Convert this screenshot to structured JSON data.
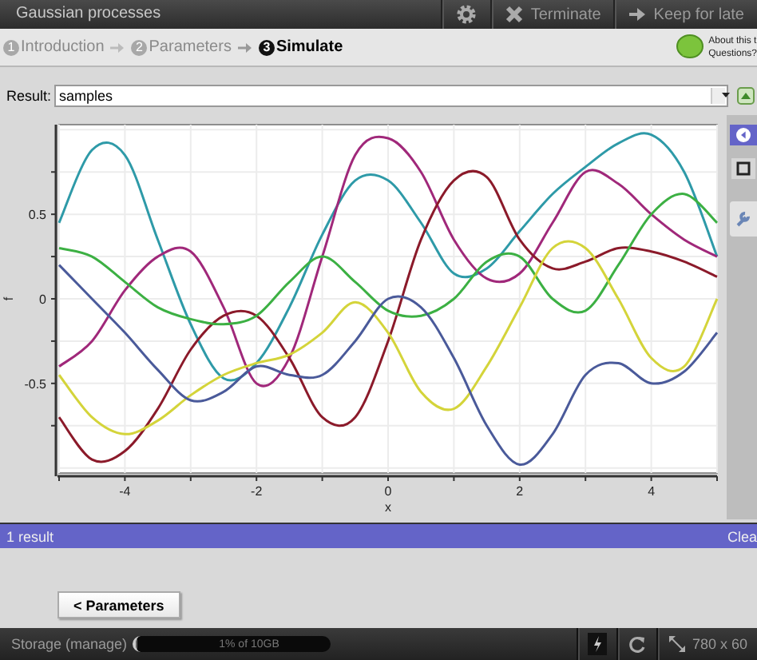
{
  "window": {
    "title": "Gaussian processes"
  },
  "toolbar": [
    {
      "kind": "gear"
    },
    {
      "kind": "close",
      "label": "Terminate"
    },
    {
      "kind": "arrow",
      "label": "Keep for late"
    }
  ],
  "steps": [
    {
      "number": "1",
      "label": "Introduction",
      "selected": false
    },
    {
      "number": "2",
      "label": "Parameters",
      "selected": false
    },
    {
      "number": "3",
      "label": "Simulate",
      "selected": true
    }
  ],
  "help": {
    "title": "About this t",
    "subtitle": "Questions?"
  },
  "result": {
    "label": "Result:",
    "value": "samples"
  },
  "chart_data": {
    "type": "line",
    "grid": true,
    "xlabel": "x",
    "ylabel": "f",
    "x": [
      -5,
      -4.5,
      -4,
      -3.5,
      -3,
      -2.5,
      -2,
      -1.5,
      -1,
      -0.5,
      0,
      0.5,
      1,
      1.5,
      2,
      2.5,
      3,
      3.5,
      4,
      4.5,
      5
    ],
    "xlim": [
      -5,
      5
    ],
    "ylim": [
      -1.03,
      1.03
    ],
    "xticks": [
      -4,
      -2,
      0,
      2,
      4
    ],
    "yticks": [
      -0.5,
      0,
      0.5
    ],
    "series": [
      {
        "color": "#2e9aa8",
        "values": [
          0.45,
          0.88,
          0.85,
          0.35,
          -0.15,
          -0.47,
          -0.38,
          -0.05,
          0.38,
          0.7,
          0.7,
          0.45,
          0.15,
          0.18,
          0.4,
          0.62,
          0.78,
          0.92,
          0.97,
          0.75,
          0.25
        ]
      },
      {
        "color": "#a0287a",
        "values": [
          -0.4,
          -0.25,
          0.05,
          0.25,
          0.28,
          -0.05,
          -0.5,
          -0.35,
          0.25,
          0.85,
          0.95,
          0.75,
          0.35,
          0.12,
          0.15,
          0.45,
          0.75,
          0.68,
          0.5,
          0.35,
          0.25
        ]
      },
      {
        "color": "#8b1a2a",
        "values": [
          -0.7,
          -0.95,
          -0.9,
          -0.65,
          -0.3,
          -0.1,
          -0.1,
          -0.35,
          -0.7,
          -0.7,
          -0.25,
          0.35,
          0.7,
          0.72,
          0.35,
          0.18,
          0.22,
          0.3,
          0.28,
          0.22,
          0.13
        ]
      },
      {
        "color": "#3cb043",
        "values": [
          0.3,
          0.25,
          0.1,
          -0.05,
          -0.12,
          -0.15,
          -0.1,
          0.1,
          0.25,
          0.1,
          -0.07,
          -0.1,
          0.0,
          0.22,
          0.25,
          0.0,
          -0.07,
          0.2,
          0.5,
          0.62,
          0.45
        ]
      },
      {
        "color": "#d4d43a",
        "values": [
          -0.45,
          -0.7,
          -0.8,
          -0.72,
          -0.57,
          -0.45,
          -0.38,
          -0.33,
          -0.2,
          -0.02,
          -0.2,
          -0.55,
          -0.65,
          -0.4,
          -0.05,
          0.3,
          0.3,
          0.0,
          -0.35,
          -0.4,
          0.0
        ]
      },
      {
        "color": "#4a5a9a",
        "values": [
          0.2,
          0.0,
          -0.2,
          -0.42,
          -0.6,
          -0.55,
          -0.4,
          -0.45,
          -0.45,
          -0.25,
          0.0,
          -0.05,
          -0.35,
          -0.75,
          -0.98,
          -0.8,
          -0.45,
          -0.38,
          -0.5,
          -0.43,
          -0.2
        ]
      }
    ]
  },
  "side_tools": [
    {
      "kind": "collapse"
    },
    {
      "kind": "square"
    },
    {
      "kind": "wrench"
    }
  ],
  "results_bar": {
    "count": "1 result",
    "action": "Clea"
  },
  "back_button": "< Parameters",
  "status_bar": {
    "storage": "Storage (manage)",
    "usage": {
      "level": 0.01,
      "label": "1% of 10GB"
    },
    "icons": [
      {
        "kind": "flash"
      },
      {
        "kind": "refresh"
      },
      {
        "kind": "resize",
        "label": "780 x 60"
      }
    ]
  }
}
